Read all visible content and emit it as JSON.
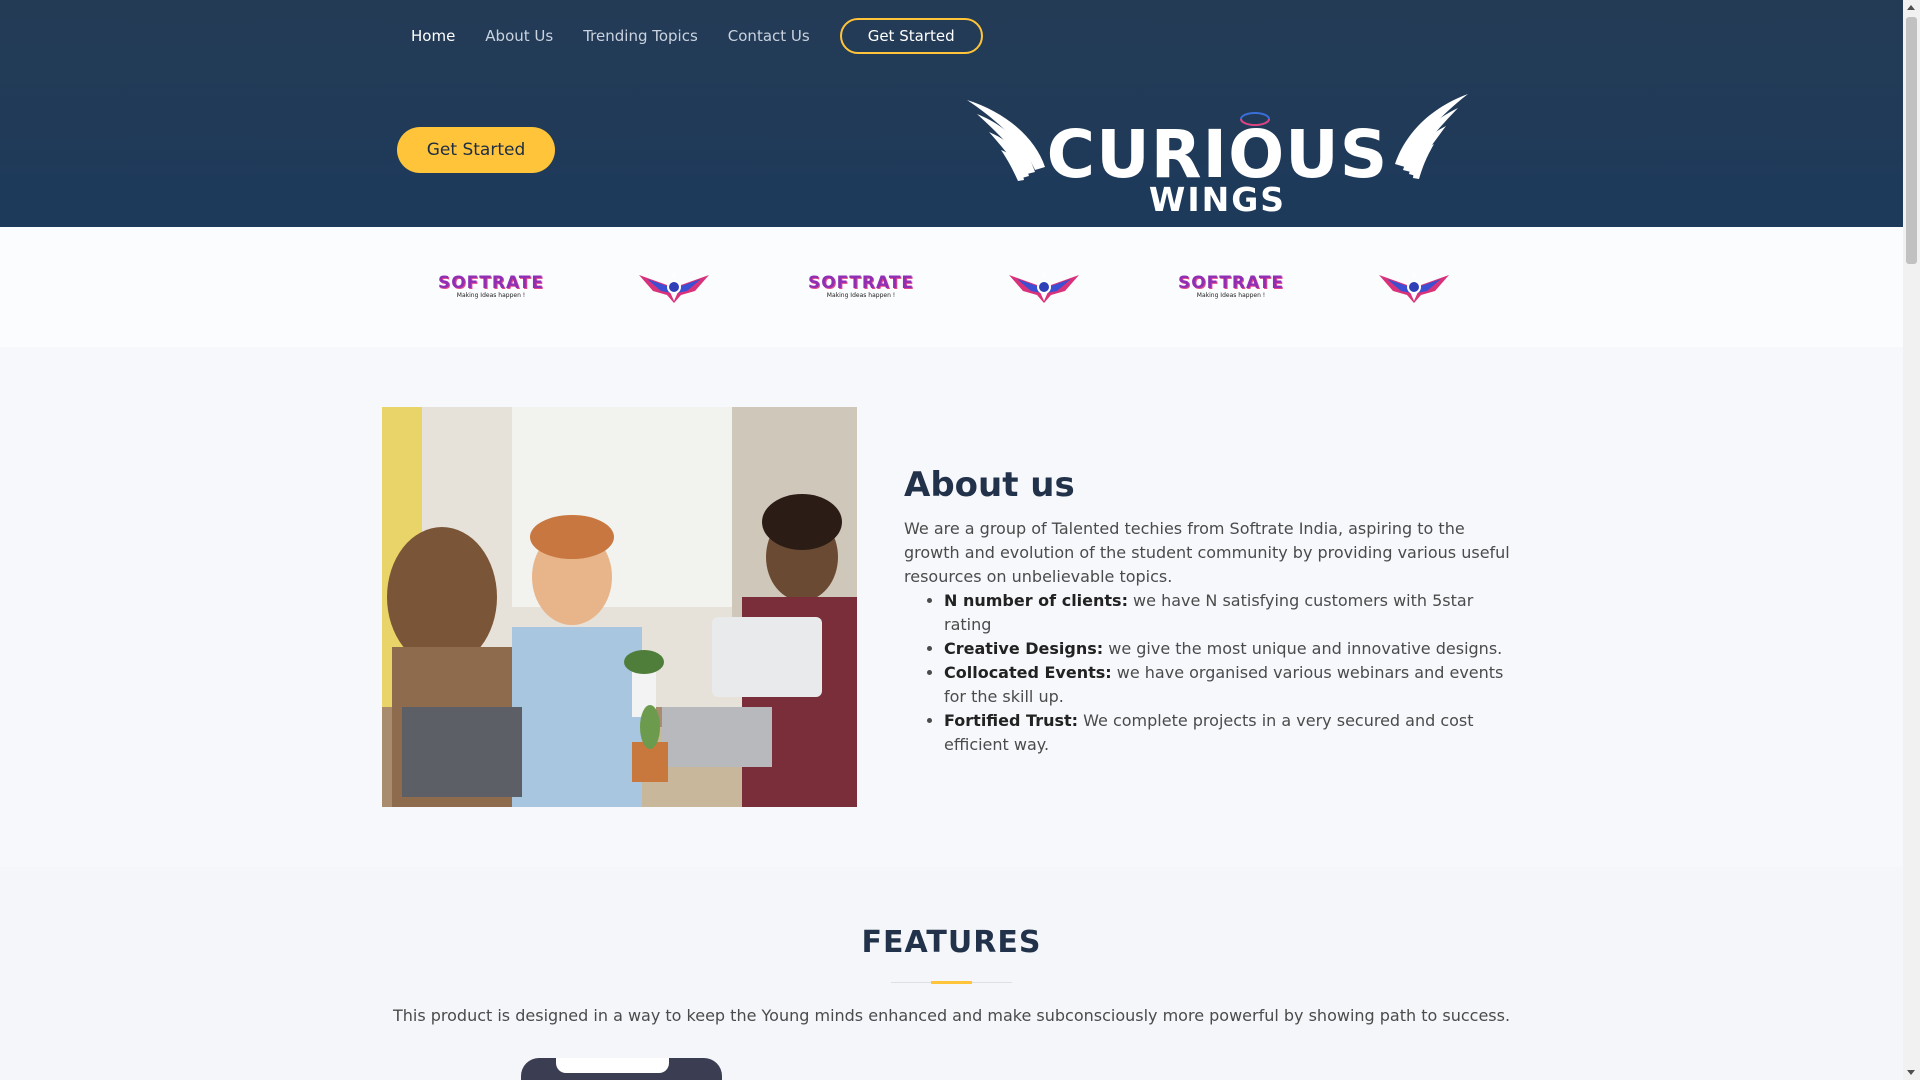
{
  "nav": {
    "items": [
      {
        "label": "Home"
      },
      {
        "label": "About Us"
      },
      {
        "label": "Trending Topics"
      },
      {
        "label": "Contact Us"
      }
    ],
    "cta_label": "Get Started"
  },
  "hero": {
    "cta_label": "Get Started",
    "brand_title": "CURIOUS",
    "brand_subtitle": "WINGS"
  },
  "clients": {
    "softrate_word": "SOFTRATE",
    "softrate_tagline": "Making Ideas happen !"
  },
  "about": {
    "title": "About us",
    "description": "We are a group of Talented techies from Softrate India, aspiring to the growth and evolution of the student community by providing various useful resources on unbelievable topics.",
    "points": [
      {
        "label": "N number of clients:",
        "text": " we have N satisfying customers with 5star rating"
      },
      {
        "label": "Creative Designs:",
        "text": " we give the most unique and innovative designs."
      },
      {
        "label": "Collocated Events:",
        "text": " we have organised various webinars and events for the skill up."
      },
      {
        "label": "Fortified Trust:",
        "text": " We complete projects in a very secured and cost efficient way."
      }
    ]
  },
  "features": {
    "title": "FEATURES",
    "description": "This product is designed in a way to keep the Young minds enhanced and make subconsciously more powerful by showing path to success."
  },
  "colors": {
    "hero_bg": "#1d3a5b",
    "accent": "#ffc439",
    "heading": "#22324a"
  }
}
